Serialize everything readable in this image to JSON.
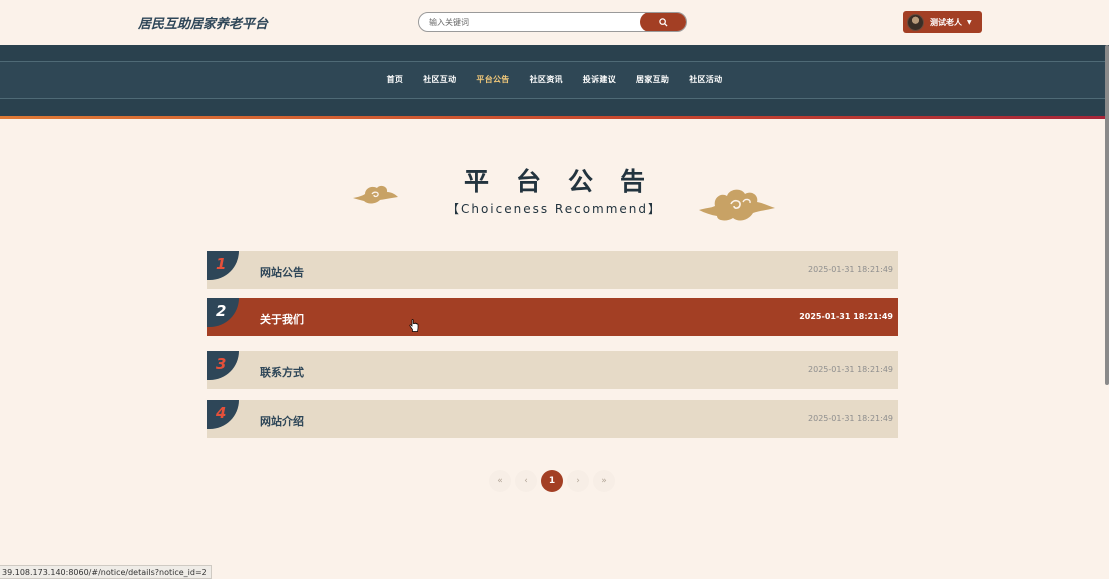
{
  "header": {
    "logo": "居民互助居家养老平台",
    "search_placeholder": "输入关键词",
    "user_name": "测试老人"
  },
  "nav": {
    "items": [
      "首页",
      "社区互动",
      "平台公告",
      "社区资讯",
      "投诉建议",
      "居家互助",
      "社区活动"
    ],
    "active_index": 2
  },
  "section": {
    "title": "平台公告",
    "subtitle": "【Choiceness Recommend】"
  },
  "notices": [
    {
      "num": "1",
      "title": "网站公告",
      "date": "2025-01-31 18:21:49",
      "active": false
    },
    {
      "num": "2",
      "title": "关于我们",
      "date": "2025-01-31 18:21:49",
      "active": true
    },
    {
      "num": "3",
      "title": "联系方式",
      "date": "2025-01-31 18:21:49",
      "active": false
    },
    {
      "num": "4",
      "title": "网站介绍",
      "date": "2025-01-31 18:21:49",
      "active": false
    }
  ],
  "pagination": {
    "first": "«",
    "prev": "‹",
    "current": "1",
    "next": "›",
    "last": "»"
  },
  "status_bar": {
    "url": "39.108.173.140:8060/#/notice/details?notice_id=2"
  },
  "colors": {
    "accent": "#a33f24",
    "navy": "#2e4658",
    "background": "#fbf2ea",
    "row": "#e6dac7",
    "gold": "#c8a265"
  }
}
